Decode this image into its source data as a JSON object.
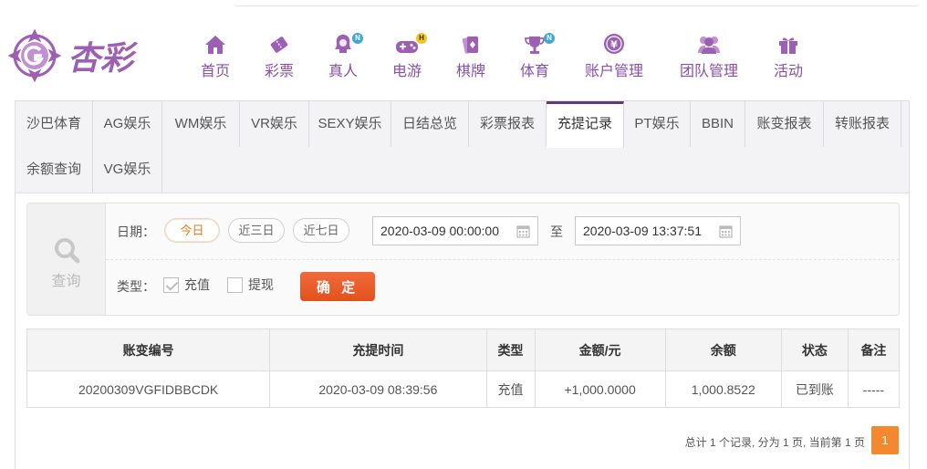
{
  "logo": {
    "text": "杏彩"
  },
  "nav": [
    {
      "label": "首页",
      "icon": "home-icon",
      "badge": ""
    },
    {
      "label": "彩票",
      "icon": "lottery-ticket-icon",
      "badge": ""
    },
    {
      "label": "真人",
      "icon": "live-dealer-icon",
      "badge": "N"
    },
    {
      "label": "电游",
      "icon": "gamepad-icon",
      "badge": "H"
    },
    {
      "label": "棋牌",
      "icon": "cards-icon",
      "badge": ""
    },
    {
      "label": "体育",
      "icon": "trophy-icon",
      "badge": "N"
    },
    {
      "label": "账户管理",
      "icon": "account-coin-icon",
      "badge": ""
    },
    {
      "label": "团队管理",
      "icon": "team-icon",
      "badge": ""
    },
    {
      "label": "活动",
      "icon": "gift-icon",
      "badge": ""
    }
  ],
  "tabs": [
    "沙巴体育",
    "AG娱乐",
    "WM娱乐",
    "VR娱乐",
    "SEXY娱乐",
    "日结总览",
    "彩票报表",
    "充提记录",
    "PT娱乐",
    "BBIN",
    "账变报表",
    "转账报表",
    "余额查询",
    "VG娱乐"
  ],
  "active_tab": "充提记录",
  "filter": {
    "side_label": "查询",
    "date_label": "日期：",
    "ranges": [
      "今日",
      "近三日",
      "近七日"
    ],
    "selected_range": "今日",
    "start": "2020-03-09 00:00:00",
    "to": "至",
    "end": "2020-03-09 13:37:51",
    "type_label": "类型：",
    "types": [
      {
        "label": "充值",
        "checked": true
      },
      {
        "label": "提现",
        "checked": false
      }
    ],
    "confirm": "确 定"
  },
  "table": {
    "headers": [
      "账变编号",
      "充提时间",
      "类型",
      "金额/元",
      "余额",
      "状态",
      "备注"
    ],
    "rows": [
      [
        "20200309VGFIDBBCDK",
        "2020-03-09 08:39:56",
        "充值",
        "+1,000.0000",
        "1,000.8522",
        "已到账",
        "-----"
      ]
    ]
  },
  "pager": {
    "summary": "总计 1 个记录, 分为 1 页, 当前第 1 页",
    "current": "1"
  },
  "colors": {
    "brand": "#9d5fb4",
    "accent": "#f3882e",
    "amount": "#c4161c",
    "status_ok": "#2aa52a"
  }
}
